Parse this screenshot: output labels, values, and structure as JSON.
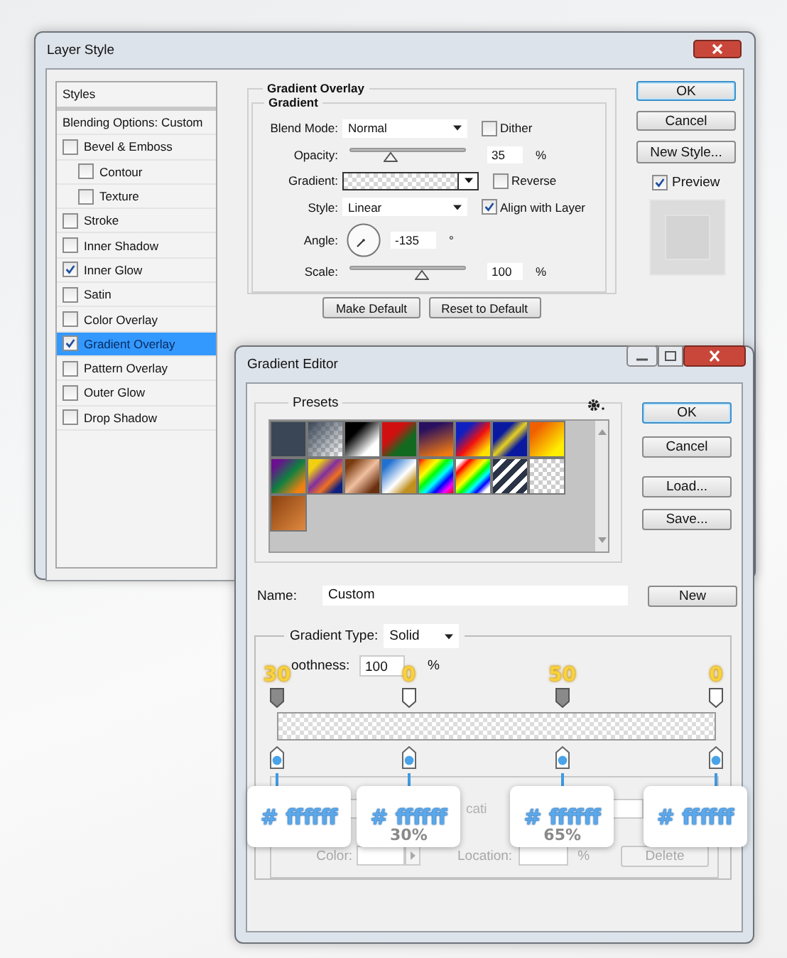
{
  "layer_style": {
    "title": "Layer Style",
    "styles_header": "Styles",
    "styles": [
      {
        "label": "Blending Options: Custom",
        "kind": "plain",
        "selected": false
      },
      {
        "label": "Bevel & Emboss",
        "kind": "check",
        "checked": false,
        "selected": false,
        "children": [
          {
            "label": "Contour",
            "kind": "check",
            "checked": false,
            "selected": false
          },
          {
            "label": "Texture",
            "kind": "check",
            "checked": false,
            "selected": false
          }
        ]
      },
      {
        "label": "Stroke",
        "kind": "check",
        "checked": false,
        "selected": false
      },
      {
        "label": "Inner Shadow",
        "kind": "check",
        "checked": false,
        "selected": false
      },
      {
        "label": "Inner Glow",
        "kind": "check",
        "checked": true,
        "selected": false
      },
      {
        "label": "Satin",
        "kind": "check",
        "checked": false,
        "selected": false
      },
      {
        "label": "Color Overlay",
        "kind": "check",
        "checked": false,
        "selected": false
      },
      {
        "label": "Gradient Overlay",
        "kind": "check",
        "checked": true,
        "selected": true
      },
      {
        "label": "Pattern Overlay",
        "kind": "check",
        "checked": false,
        "selected": false
      },
      {
        "label": "Outer Glow",
        "kind": "check",
        "checked": false,
        "selected": false
      },
      {
        "label": "Drop Shadow",
        "kind": "check",
        "checked": false,
        "selected": false
      }
    ],
    "section_title": "Gradient Overlay",
    "group_title": "Gradient",
    "blend_mode": {
      "label": "Blend Mode:",
      "value": "Normal"
    },
    "dither": {
      "label": "Dither",
      "checked": false
    },
    "opacity": {
      "label": "Opacity:",
      "level": 0.35,
      "value": "35",
      "unit": "%"
    },
    "gradient": {
      "label": "Gradient:"
    },
    "reverse": {
      "label": "Reverse",
      "checked": false
    },
    "style": {
      "label": "Style:",
      "value": "Linear"
    },
    "align": {
      "label": "Align with Layer",
      "checked": true
    },
    "angle": {
      "label": "Angle:",
      "value": "-135",
      "unit": "°"
    },
    "scale": {
      "label": "Scale:",
      "level": 0.62,
      "value": "100",
      "unit": "%"
    },
    "buttons": [
      "Make Default",
      "Reset to Default"
    ],
    "side_buttons": [
      {
        "label": "OK",
        "default": true
      },
      {
        "label": "Cancel",
        "default": false
      },
      {
        "label": "New Style...",
        "default": false
      }
    ],
    "preview": {
      "label": "Preview",
      "checked": true
    }
  },
  "gradient_editor": {
    "title": "Gradient Editor",
    "presets_title": "Presets",
    "side_buttons": [
      {
        "label": "OK",
        "default": true
      },
      {
        "label": "Cancel",
        "default": false
      },
      {
        "label": "Load...",
        "default": false
      },
      {
        "label": "Save...",
        "default": false
      }
    ],
    "name": {
      "label": "Name:",
      "value": "Custom"
    },
    "new_button": "New",
    "gradient_type": {
      "label": "Gradient Type:",
      "value": "Solid"
    },
    "smoothness": {
      "label": "oothness:",
      "value": "100",
      "unit": "%"
    },
    "opacity_stops": [
      {
        "level": 0,
        "filled": true,
        "note": "30"
      },
      {
        "level": 0.3,
        "filled": false,
        "note": "0"
      },
      {
        "level": 0.65,
        "filled": true,
        "note": "50"
      },
      {
        "level": 1,
        "filled": false,
        "note": "0"
      }
    ],
    "color_stops": [
      {
        "level": 0,
        "callout": "# ffffff"
      },
      {
        "level": 0.3,
        "callout": "# ffffff",
        "location_note": "30%"
      },
      {
        "level": 0.65,
        "callout": "# ffffff",
        "location_note": "65%"
      },
      {
        "level": 1,
        "callout": "# ffffff"
      }
    ],
    "stops_fragment": "cati",
    "color_row": {
      "color_label": "Color:",
      "location_label": "Location:",
      "unit": "%",
      "delete": "Delete",
      "disabled": true
    }
  }
}
